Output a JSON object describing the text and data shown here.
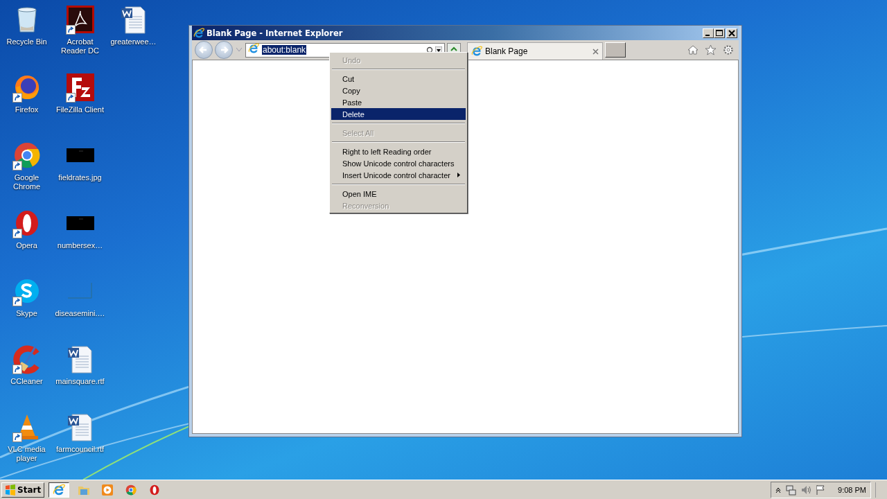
{
  "desktop": {
    "icons": [
      {
        "label": "Recycle Bin",
        "kind": "recycle",
        "shortcut": false
      },
      {
        "label": "Firefox",
        "kind": "firefox",
        "shortcut": true
      },
      {
        "label": "Google Chrome",
        "kind": "chrome",
        "shortcut": true
      },
      {
        "label": "Opera",
        "kind": "opera",
        "shortcut": true
      },
      {
        "label": "Skype",
        "kind": "skype",
        "shortcut": true
      },
      {
        "label": "CCleaner",
        "kind": "ccleaner",
        "shortcut": true
      },
      {
        "label": "VLC media player",
        "kind": "vlc",
        "shortcut": true
      },
      {
        "label": "Acrobat Reader DC",
        "kind": "acrobat",
        "shortcut": true
      },
      {
        "label": "FileZilla Client",
        "kind": "filezilla",
        "shortcut": true
      },
      {
        "label": "fieldrates.jpg",
        "kind": "image",
        "shortcut": false
      },
      {
        "label": "numbersex…",
        "kind": "image",
        "shortcut": false
      },
      {
        "label": "diseasemini.…",
        "kind": "blank",
        "shortcut": false
      },
      {
        "label": "mainsquare.rtf",
        "kind": "word",
        "shortcut": false
      },
      {
        "label": "farmcouncil.rtf",
        "kind": "word",
        "shortcut": false
      },
      {
        "label": "greaterwee…",
        "kind": "word",
        "shortcut": false
      }
    ]
  },
  "window": {
    "title": "Blank Page - Internet Explorer",
    "address": {
      "value": "about:blank",
      "selected": true
    },
    "tab": {
      "label": "Blank Page",
      "selected": true
    }
  },
  "context_menu": [
    {
      "kind": "item",
      "label": "Undo",
      "disabled": true,
      "selected": false
    },
    {
      "kind": "separator"
    },
    {
      "kind": "item",
      "label": "Cut",
      "disabled": false,
      "selected": false
    },
    {
      "kind": "item",
      "label": "Copy",
      "disabled": false,
      "selected": false
    },
    {
      "kind": "item",
      "label": "Paste",
      "disabled": false,
      "selected": false
    },
    {
      "kind": "item",
      "label": "Delete",
      "disabled": false,
      "selected": true
    },
    {
      "kind": "separator"
    },
    {
      "kind": "item",
      "label": "Select All",
      "disabled": true,
      "selected": false
    },
    {
      "kind": "separator"
    },
    {
      "kind": "item",
      "label": "Right to left Reading order",
      "disabled": false,
      "selected": false
    },
    {
      "kind": "item",
      "label": "Show Unicode control characters",
      "disabled": false,
      "selected": false
    },
    {
      "kind": "submenu",
      "label": "Insert Unicode control character",
      "disabled": false,
      "selected": false
    },
    {
      "kind": "separator"
    },
    {
      "kind": "item",
      "label": "Open IME",
      "disabled": false,
      "selected": false
    },
    {
      "kind": "item",
      "label": "Reconversion",
      "disabled": true,
      "selected": false
    }
  ],
  "taskbar": {
    "start": "Start",
    "apps": [
      {
        "kind": "ie",
        "active": true
      },
      {
        "kind": "folder",
        "active": false
      },
      {
        "kind": "media",
        "active": false
      },
      {
        "kind": "chrome",
        "active": false
      },
      {
        "kind": "opera",
        "active": false
      }
    ],
    "clock": "9:08 PM"
  }
}
